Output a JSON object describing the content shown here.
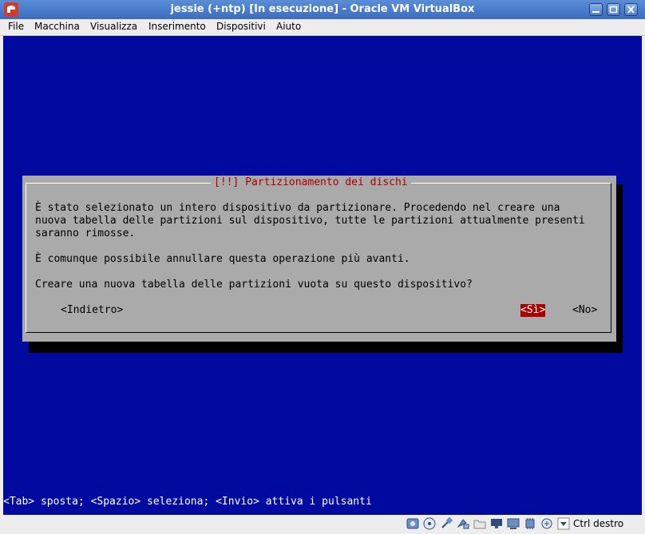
{
  "window": {
    "title": "jessie (+ntp) [In esecuzione] - Oracle VM VirtualBox"
  },
  "menu": [
    "File",
    "Macchina",
    "Visualizza",
    "Inserimento",
    "Dispositivi",
    "Aiuto"
  ],
  "dialog": {
    "title": "[!!] Partizionamento dei dischi",
    "lines": [
      "È stato selezionato un intero dispositivo da partizionare. Procedendo nel creare una",
      "nuova tabella delle partizioni sul dispositivo, tutte le partizioni attualmente presenti",
      "saranno rimosse.",
      "",
      "È comunque possibile annullare questa operazione più avanti.",
      "",
      "Creare una nuova tabella delle partizioni vuota su questo dispositivo?"
    ],
    "buttons": {
      "back": "<Indietro>",
      "yes": "<Sì>",
      "no": "<No>"
    }
  },
  "hint": "<Tab> sposta; <Spazio> seleziona; <Invio> attiva i pulsanti",
  "statusbar": {
    "icons": [
      "hard-disk-icon",
      "optical-disk-icon",
      "usb-icon",
      "shared-folders-icon",
      "folder-icon",
      "network-icon",
      "display-icon",
      "cpu-icon",
      "mouse-integration-icon",
      "arrow-down-icon"
    ],
    "host_key": "Ctrl destro"
  },
  "colors": {
    "vm_background": "#000a9e",
    "dialog_bg": "#aaaaaa",
    "dialog_title": "#a80000",
    "selected_button_bg": "#a80000"
  }
}
